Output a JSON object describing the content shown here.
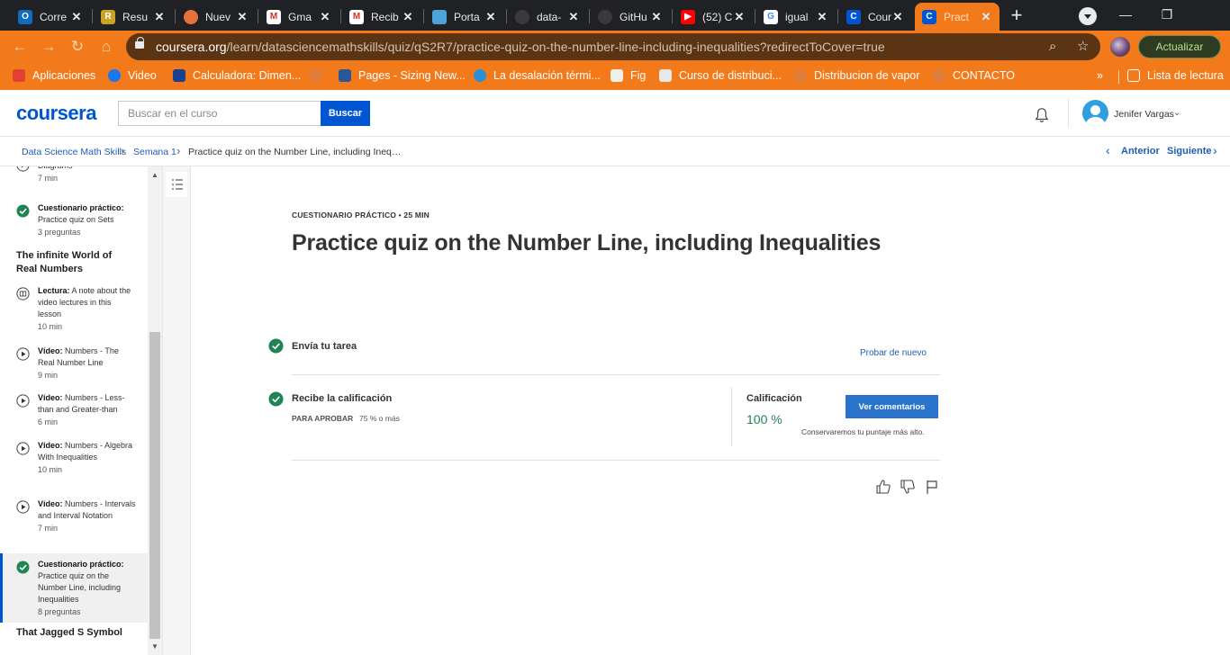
{
  "browser": {
    "tabs": [
      {
        "title": "Corre",
        "favicon": "outlook-icon",
        "color": "#0f6cbd",
        "glyph": "O"
      },
      {
        "title": "Resu",
        "favicon": "resume-icon",
        "color": "#c9a227",
        "glyph": "R"
      },
      {
        "title": "Nuev",
        "favicon": "chrome-icon",
        "color": "#e7713c",
        "glyph": ""
      },
      {
        "title": "Gma",
        "favicon": "gmail-icon",
        "color": "#ffffff",
        "glyph": "M"
      },
      {
        "title": "Recib",
        "favicon": "gmail-icon",
        "color": "#ffffff",
        "glyph": "M"
      },
      {
        "title": "Porta",
        "favicon": "portal-icon",
        "color": "#4da3d9",
        "glyph": ""
      },
      {
        "title": "data-",
        "favicon": "github-icon",
        "color": "#3a3a3a",
        "glyph": ""
      },
      {
        "title": "GitHu",
        "favicon": "github-icon",
        "color": "#3a3a3a",
        "glyph": ""
      },
      {
        "title": "(52) C",
        "favicon": "youtube-icon",
        "color": "#ff0000",
        "glyph": "▶"
      },
      {
        "title": "igual",
        "favicon": "google-icon",
        "color": "#ffffff",
        "glyph": "G"
      },
      {
        "title": "Cour",
        "favicon": "coursera-icon",
        "color": "#0056d2",
        "glyph": "C"
      },
      {
        "title": "Pract",
        "favicon": "coursera-icon",
        "color": "#0056d2",
        "glyph": "C",
        "active": true
      }
    ],
    "url_host": "coursera.org",
    "url_path": "/learn/datasciencemathskills/quiz/qS2R7/practice-quiz-on-the-number-line-including-inequalities?redirectToCover=true",
    "update_label": "Actualizar",
    "accent": "#f27a1a",
    "bookmarks": [
      {
        "label": "Aplicaciones",
        "icon": "apps-grid-icon",
        "color": "#e34133"
      },
      {
        "label": "Video",
        "icon": "facebook-icon",
        "color": "#1877f2"
      },
      {
        "label": "Calculadora: Dimen...",
        "icon": "tlv-icon",
        "color": "#1b3f91"
      },
      {
        "label": "",
        "icon": "globe-icon",
        "color": "#d9824a"
      },
      {
        "label": "Pages - Sizing New...",
        "icon": "pages-icon",
        "color": "#2b5797"
      },
      {
        "label": "La desalación térmi...",
        "icon": "gear-icon",
        "color": "#2a8fd6"
      },
      {
        "label": "Fig",
        "icon": "pin-icon",
        "color": "#f2efe8"
      },
      {
        "label": "Curso de distribuci...",
        "icon": "star-badge-icon",
        "color": "#e9e9e9"
      },
      {
        "label": "Distribucion de vapor",
        "icon": "globe-icon",
        "color": "#d9824a"
      },
      {
        "label": "CONTACTO",
        "icon": "globe-icon",
        "color": "#d9824a"
      }
    ],
    "overflow_label": "»",
    "reading_list_label": "Lista de lectura"
  },
  "header": {
    "logo": "coursera",
    "search_placeholder": "Buscar en el curso",
    "search_button": "Buscar",
    "user_name": "Jenifer Vargas",
    "brand_color": "#0056d2"
  },
  "breadcrumb": {
    "items": [
      "Data Science Math Skills",
      "Semana 1",
      "Practice quiz on the Number Line, including Ineq…"
    ],
    "prev": "Anterior",
    "next": "Siguiente"
  },
  "sidebar": {
    "items": [
      {
        "type_label": "",
        "title": "Diagrams",
        "meta": "7 min",
        "icon": "play-circle-icon",
        "state": "partial"
      },
      {
        "type_label": "Cuestionario práctico:",
        "title": "Practice quiz on Sets",
        "meta": "3 preguntas",
        "icon": "check-circle-icon",
        "state": "done"
      },
      {
        "type_label": "Lectura:",
        "title": "A note about the video lectures in this lesson",
        "meta": "10 min",
        "icon": "book-icon",
        "state": "todo"
      },
      {
        "type_label": "Vídeo:",
        "title": "Numbers - The Real Number Line",
        "meta": "9 min",
        "icon": "play-circle-icon",
        "state": "todo"
      },
      {
        "type_label": "Vídeo:",
        "title": "Numbers - Less-than and Greater-than",
        "meta": "6 min",
        "icon": "play-circle-icon",
        "state": "todo"
      },
      {
        "type_label": "Vídeo:",
        "title": "Numbers - Algebra With Inequalities",
        "meta": "10 min",
        "icon": "play-circle-icon",
        "state": "todo"
      },
      {
        "type_label": "Vídeo:",
        "title": "Numbers - Intervals and Interval Notation",
        "meta": "7 min",
        "icon": "play-circle-icon",
        "state": "todo"
      },
      {
        "type_label": "Cuestionario práctico:",
        "title": "Practice quiz on the Number Line, including Inequalities",
        "meta": "8 preguntas",
        "icon": "check-circle-icon",
        "state": "done",
        "active": true
      }
    ],
    "sections": [
      "The infinite World of Real Numbers",
      "That Jagged S Symbol"
    ]
  },
  "main": {
    "overline": "CUESTIONARIO PRÁCTICO • 25 MIN",
    "title": "Practice quiz on the Number Line, including Inequalities",
    "step1_title": "Envía tu tarea",
    "retry_label": "Probar de nuevo",
    "step2_title": "Recibe la calificación",
    "pass_label": "PARA APROBAR",
    "pass_value": "75 % o más",
    "grade_label": "Calificación",
    "grade_value": "100 %",
    "feedback_button": "Ver comentarios",
    "keep_note": "Conservaremos tu puntaje más alto.",
    "success_color": "#1f8354"
  }
}
